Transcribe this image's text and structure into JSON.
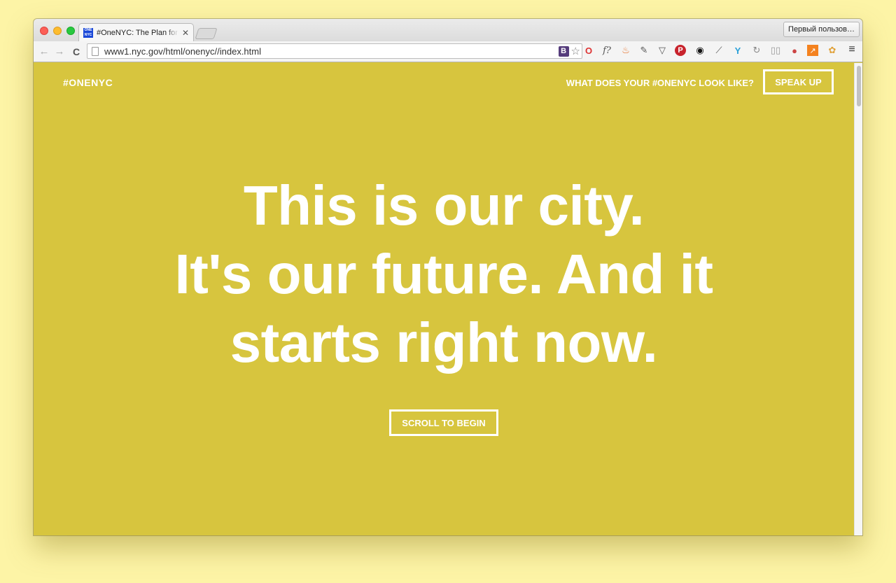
{
  "browser": {
    "tab_title": "#OneNYC: The Plan for a Strong and Just City",
    "tab_favicon_text": "ONE NYC",
    "tab_close": "✕",
    "profile_label": "Первый пользов…",
    "url": "www1.nyc.gov/html/onenyc//index.html",
    "bookmark_ext_label": "B",
    "font_ext_label": "f?",
    "nav_back_icon": "←",
    "nav_forward_icon": "→",
    "reload_icon": "C",
    "star_icon": "☆",
    "menu_icon": "≡",
    "extensions": [
      "opera-icon",
      "whatfont-icon",
      "fire-icon",
      "evernote-icon",
      "pocket-icon",
      "pinterest-icon",
      "color-picker-icon",
      "eyedropper-icon",
      "vpn-icon",
      "sync-icon",
      "reader-icon",
      "cookie-icon",
      "analytics-icon",
      "puzzle-icon"
    ]
  },
  "page": {
    "logo": "#ONENYC",
    "cta_text": "WHAT DOES YOUR #ONENYC LOOK LIKE?",
    "speak_button": "SPEAK UP",
    "hero_line1": "This is our city.",
    "hero_line2": "It's our future. And it",
    "hero_line3": "starts right now.",
    "scroll_button": "SCROLL TO BEGIN"
  },
  "colors": {
    "background": "#d7c53e",
    "desktop": "#fdf4a6",
    "text": "#ffffff"
  }
}
